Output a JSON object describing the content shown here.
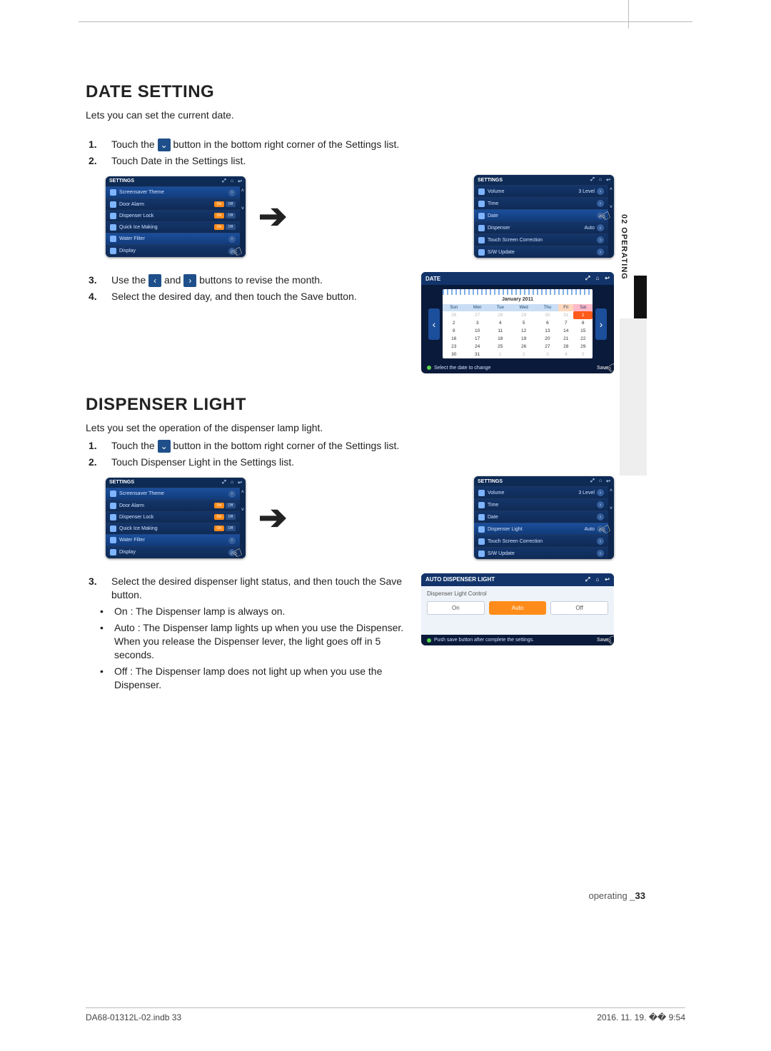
{
  "side_tab": "02  OPERATING",
  "section1": {
    "title": "DATE SETTING",
    "lede": "Lets you can set the current date.",
    "step1_a": "Touch the ",
    "step1_b": " button in the bottom right corner of the Settings list.",
    "step2": "Touch Date in the Settings list.",
    "step3_a": "Use the ",
    "step3_b": " and ",
    "step3_c": " buttons to revise the month.",
    "step4": "Select the desired day, and then touch the Save button."
  },
  "settings_left": {
    "title": "SETTINGS",
    "items": [
      "Screensaver Theme",
      "Door Alarm",
      "Dispenser Lock",
      "Quick Ice Making",
      "Water Filter",
      "Display"
    ]
  },
  "settings_right1": {
    "title": "SETTINGS",
    "volume_level": "3 Level",
    "items": [
      "Volume",
      "Time",
      "Date",
      "Dispenser",
      "Touch Screen Correction",
      "S/W Update"
    ],
    "auto": "Auto"
  },
  "date_panel": {
    "title": "DATE",
    "month_year": "January 2011",
    "dows": [
      "Sun",
      "Mon",
      "Tue",
      "Wed",
      "Thu",
      "Fri",
      "Sat"
    ],
    "hint": "Select the date to change",
    "save": "Save"
  },
  "section2": {
    "title": "DISPENSER LIGHT",
    "lede": "Lets you set the operation of the dispenser lamp light.",
    "step1_a": "Touch the ",
    "step1_b": " button in the bottom right corner of the Settings list.",
    "step2": "Touch Dispenser Light in the Settings list.",
    "step3": "Select the desired dispenser light status, and then touch the Save button.",
    "b1": "On : The Dispenser lamp is always on.",
    "b2": "Auto : The Dispenser lamp lights up when you use the Dispenser. When you release the Dispenser lever, the light goes off in 5 seconds.",
    "b3": "Off : The Dispenser lamp does not light up when you use the Dispenser."
  },
  "settings_right2": {
    "title": "SETTINGS",
    "volume_level": "3 Level",
    "items": [
      "Volume",
      "Time",
      "Date",
      "Dispenser Light",
      "Touch Screen Correction",
      "S/W Update"
    ],
    "auto": "Auto"
  },
  "dl_panel": {
    "title": "AUTO DISPENSER LIGHT",
    "control_label": "Dispenser Light Control",
    "opts": [
      "On",
      "Auto",
      "Off"
    ],
    "hint": "Push save button after complete the settings.",
    "save": "Save"
  },
  "footer": {
    "label": "operating _",
    "page": "33"
  },
  "printfoot": {
    "left": "DA68-01312L-02.indb   33",
    "right": "2016. 11. 19.   �� 9:54"
  },
  "chart_data": {
    "type": "table",
    "title": "January 2011",
    "columns": [
      "Sun",
      "Mon",
      "Tue",
      "Wed",
      "Thu",
      "Fri",
      "Sat"
    ],
    "rows": [
      [
        26,
        27,
        28,
        29,
        30,
        31,
        1
      ],
      [
        2,
        3,
        4,
        5,
        6,
        7,
        8
      ],
      [
        9,
        10,
        11,
        12,
        13,
        14,
        15
      ],
      [
        16,
        17,
        18,
        19,
        20,
        21,
        22
      ],
      [
        23,
        24,
        25,
        26,
        27,
        28,
        29
      ],
      [
        30,
        31,
        1,
        2,
        3,
        4,
        5
      ]
    ],
    "selected": "1 (Sat, row 0)"
  }
}
